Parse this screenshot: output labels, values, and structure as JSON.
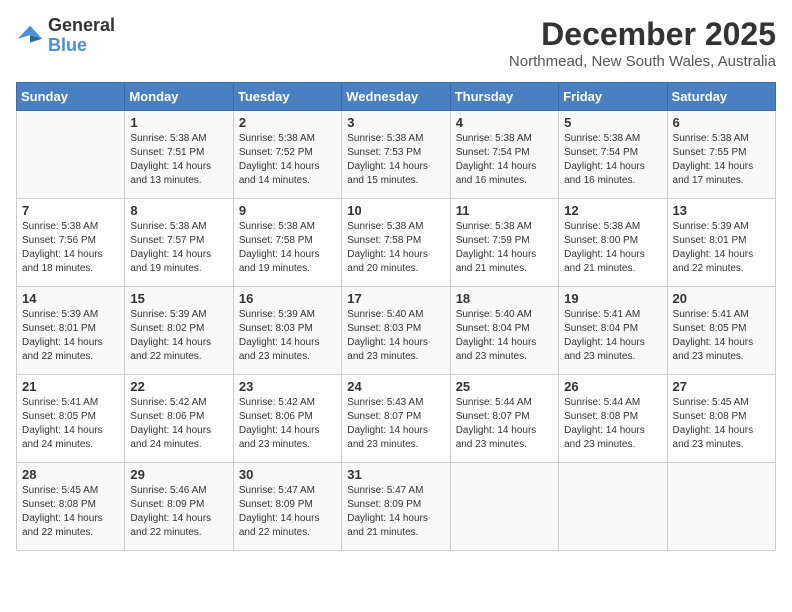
{
  "logo": {
    "general": "General",
    "blue": "Blue"
  },
  "title": "December 2025",
  "subtitle": "Northmead, New South Wales, Australia",
  "days_of_week": [
    "Sunday",
    "Monday",
    "Tuesday",
    "Wednesday",
    "Thursday",
    "Friday",
    "Saturday"
  ],
  "weeks": [
    [
      {
        "day": "",
        "sunrise": "",
        "sunset": "",
        "daylight": ""
      },
      {
        "day": "1",
        "sunrise": "Sunrise: 5:38 AM",
        "sunset": "Sunset: 7:51 PM",
        "daylight": "Daylight: 14 hours and 13 minutes."
      },
      {
        "day": "2",
        "sunrise": "Sunrise: 5:38 AM",
        "sunset": "Sunset: 7:52 PM",
        "daylight": "Daylight: 14 hours and 14 minutes."
      },
      {
        "day": "3",
        "sunrise": "Sunrise: 5:38 AM",
        "sunset": "Sunset: 7:53 PM",
        "daylight": "Daylight: 14 hours and 15 minutes."
      },
      {
        "day": "4",
        "sunrise": "Sunrise: 5:38 AM",
        "sunset": "Sunset: 7:54 PM",
        "daylight": "Daylight: 14 hours and 16 minutes."
      },
      {
        "day": "5",
        "sunrise": "Sunrise: 5:38 AM",
        "sunset": "Sunset: 7:54 PM",
        "daylight": "Daylight: 14 hours and 16 minutes."
      },
      {
        "day": "6",
        "sunrise": "Sunrise: 5:38 AM",
        "sunset": "Sunset: 7:55 PM",
        "daylight": "Daylight: 14 hours and 17 minutes."
      }
    ],
    [
      {
        "day": "7",
        "sunrise": "Sunrise: 5:38 AM",
        "sunset": "Sunset: 7:56 PM",
        "daylight": "Daylight: 14 hours and 18 minutes."
      },
      {
        "day": "8",
        "sunrise": "Sunrise: 5:38 AM",
        "sunset": "Sunset: 7:57 PM",
        "daylight": "Daylight: 14 hours and 19 minutes."
      },
      {
        "day": "9",
        "sunrise": "Sunrise: 5:38 AM",
        "sunset": "Sunset: 7:58 PM",
        "daylight": "Daylight: 14 hours and 19 minutes."
      },
      {
        "day": "10",
        "sunrise": "Sunrise: 5:38 AM",
        "sunset": "Sunset: 7:58 PM",
        "daylight": "Daylight: 14 hours and 20 minutes."
      },
      {
        "day": "11",
        "sunrise": "Sunrise: 5:38 AM",
        "sunset": "Sunset: 7:59 PM",
        "daylight": "Daylight: 14 hours and 21 minutes."
      },
      {
        "day": "12",
        "sunrise": "Sunrise: 5:38 AM",
        "sunset": "Sunset: 8:00 PM",
        "daylight": "Daylight: 14 hours and 21 minutes."
      },
      {
        "day": "13",
        "sunrise": "Sunrise: 5:39 AM",
        "sunset": "Sunset: 8:01 PM",
        "daylight": "Daylight: 14 hours and 22 minutes."
      }
    ],
    [
      {
        "day": "14",
        "sunrise": "Sunrise: 5:39 AM",
        "sunset": "Sunset: 8:01 PM",
        "daylight": "Daylight: 14 hours and 22 minutes."
      },
      {
        "day": "15",
        "sunrise": "Sunrise: 5:39 AM",
        "sunset": "Sunset: 8:02 PM",
        "daylight": "Daylight: 14 hours and 22 minutes."
      },
      {
        "day": "16",
        "sunrise": "Sunrise: 5:39 AM",
        "sunset": "Sunset: 8:03 PM",
        "daylight": "Daylight: 14 hours and 23 minutes."
      },
      {
        "day": "17",
        "sunrise": "Sunrise: 5:40 AM",
        "sunset": "Sunset: 8:03 PM",
        "daylight": "Daylight: 14 hours and 23 minutes."
      },
      {
        "day": "18",
        "sunrise": "Sunrise: 5:40 AM",
        "sunset": "Sunset: 8:04 PM",
        "daylight": "Daylight: 14 hours and 23 minutes."
      },
      {
        "day": "19",
        "sunrise": "Sunrise: 5:41 AM",
        "sunset": "Sunset: 8:04 PM",
        "daylight": "Daylight: 14 hours and 23 minutes."
      },
      {
        "day": "20",
        "sunrise": "Sunrise: 5:41 AM",
        "sunset": "Sunset: 8:05 PM",
        "daylight": "Daylight: 14 hours and 23 minutes."
      }
    ],
    [
      {
        "day": "21",
        "sunrise": "Sunrise: 5:41 AM",
        "sunset": "Sunset: 8:05 PM",
        "daylight": "Daylight: 14 hours and 24 minutes."
      },
      {
        "day": "22",
        "sunrise": "Sunrise: 5:42 AM",
        "sunset": "Sunset: 8:06 PM",
        "daylight": "Daylight: 14 hours and 24 minutes."
      },
      {
        "day": "23",
        "sunrise": "Sunrise: 5:42 AM",
        "sunset": "Sunset: 8:06 PM",
        "daylight": "Daylight: 14 hours and 23 minutes."
      },
      {
        "day": "24",
        "sunrise": "Sunrise: 5:43 AM",
        "sunset": "Sunset: 8:07 PM",
        "daylight": "Daylight: 14 hours and 23 minutes."
      },
      {
        "day": "25",
        "sunrise": "Sunrise: 5:44 AM",
        "sunset": "Sunset: 8:07 PM",
        "daylight": "Daylight: 14 hours and 23 minutes."
      },
      {
        "day": "26",
        "sunrise": "Sunrise: 5:44 AM",
        "sunset": "Sunset: 8:08 PM",
        "daylight": "Daylight: 14 hours and 23 minutes."
      },
      {
        "day": "27",
        "sunrise": "Sunrise: 5:45 AM",
        "sunset": "Sunset: 8:08 PM",
        "daylight": "Daylight: 14 hours and 23 minutes."
      }
    ],
    [
      {
        "day": "28",
        "sunrise": "Sunrise: 5:45 AM",
        "sunset": "Sunset: 8:08 PM",
        "daylight": "Daylight: 14 hours and 22 minutes."
      },
      {
        "day": "29",
        "sunrise": "Sunrise: 5:46 AM",
        "sunset": "Sunset: 8:09 PM",
        "daylight": "Daylight: 14 hours and 22 minutes."
      },
      {
        "day": "30",
        "sunrise": "Sunrise: 5:47 AM",
        "sunset": "Sunset: 8:09 PM",
        "daylight": "Daylight: 14 hours and 22 minutes."
      },
      {
        "day": "31",
        "sunrise": "Sunrise: 5:47 AM",
        "sunset": "Sunset: 8:09 PM",
        "daylight": "Daylight: 14 hours and 21 minutes."
      },
      {
        "day": "",
        "sunrise": "",
        "sunset": "",
        "daylight": ""
      },
      {
        "day": "",
        "sunrise": "",
        "sunset": "",
        "daylight": ""
      },
      {
        "day": "",
        "sunrise": "",
        "sunset": "",
        "daylight": ""
      }
    ]
  ]
}
